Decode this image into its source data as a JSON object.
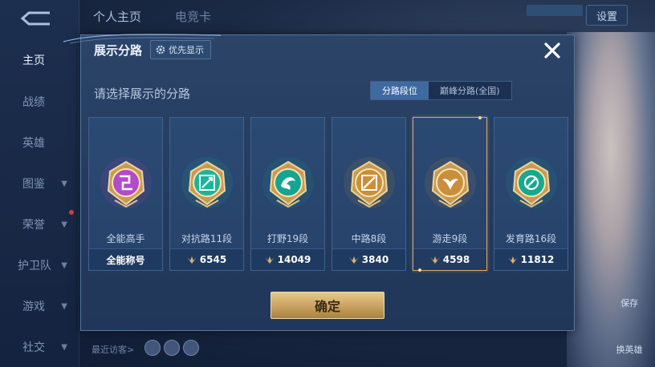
{
  "sidebar": {
    "items": [
      {
        "label": "主页",
        "active": true
      },
      {
        "label": "战绩"
      },
      {
        "label": "英雄"
      },
      {
        "label": "图鉴"
      },
      {
        "label": "荣誉"
      },
      {
        "label": "护卫队"
      },
      {
        "label": "游戏"
      },
      {
        "label": "社交"
      }
    ]
  },
  "top": {
    "tabs": [
      "个人主页",
      "电竞卡"
    ],
    "settings_label": "设置"
  },
  "background": {
    "visitors_label": "最近访客>",
    "right_buttons": [
      "保存",
      "换英雄"
    ]
  },
  "dialog": {
    "title": "展示分路",
    "pref_button": "优先显示",
    "subtitle": "请选择展示的分路",
    "segments": [
      {
        "label": "分路段位",
        "active": true
      },
      {
        "label": "巅峰分路(全国)",
        "active": false
      }
    ],
    "cards": [
      {
        "name": "全能高手",
        "value": "全能称号",
        "icon": false,
        "emblem_color": "#b34bc8",
        "selected": false
      },
      {
        "name": "对抗路11段",
        "value": "6545",
        "icon": true,
        "emblem_color": "#1eb39a",
        "selected": false
      },
      {
        "name": "打野19段",
        "value": "14049",
        "icon": true,
        "emblem_color": "#13a58f",
        "selected": false
      },
      {
        "name": "中路8段",
        "value": "3840",
        "icon": true,
        "emblem_color": "#c98f3c",
        "selected": false
      },
      {
        "name": "游走9段",
        "value": "4598",
        "icon": true,
        "emblem_color": "#c98f3c",
        "selected": true
      },
      {
        "name": "发育路16段",
        "value": "11812",
        "icon": true,
        "emblem_color": "#16a891",
        "selected": false
      }
    ],
    "confirm_label": "确定"
  }
}
